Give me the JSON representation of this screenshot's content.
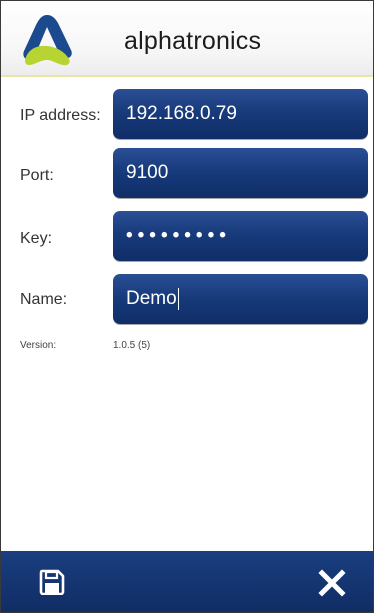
{
  "header": {
    "title": "alphatronics",
    "logo_icon": "alphatronics-logo-icon",
    "colors": {
      "logo_blue": "#1b4a8f",
      "logo_green": "#b8d433"
    }
  },
  "form": {
    "ip": {
      "label": "IP address:",
      "value": "192.168.0.79"
    },
    "port": {
      "label": "Port:",
      "value": "9100"
    },
    "key": {
      "label": "Key:",
      "value": "•••••••••"
    },
    "name": {
      "label": "Name:",
      "value": "Demo"
    }
  },
  "version": {
    "label": "Version:",
    "value": "1.0.5 (5)"
  },
  "bottom_bar": {
    "save_icon": "save-icon",
    "close_icon": "close-icon",
    "color": "#12336f"
  },
  "colors": {
    "field_blue": "#183b7c",
    "header_rule": "#e6e7a6"
  }
}
